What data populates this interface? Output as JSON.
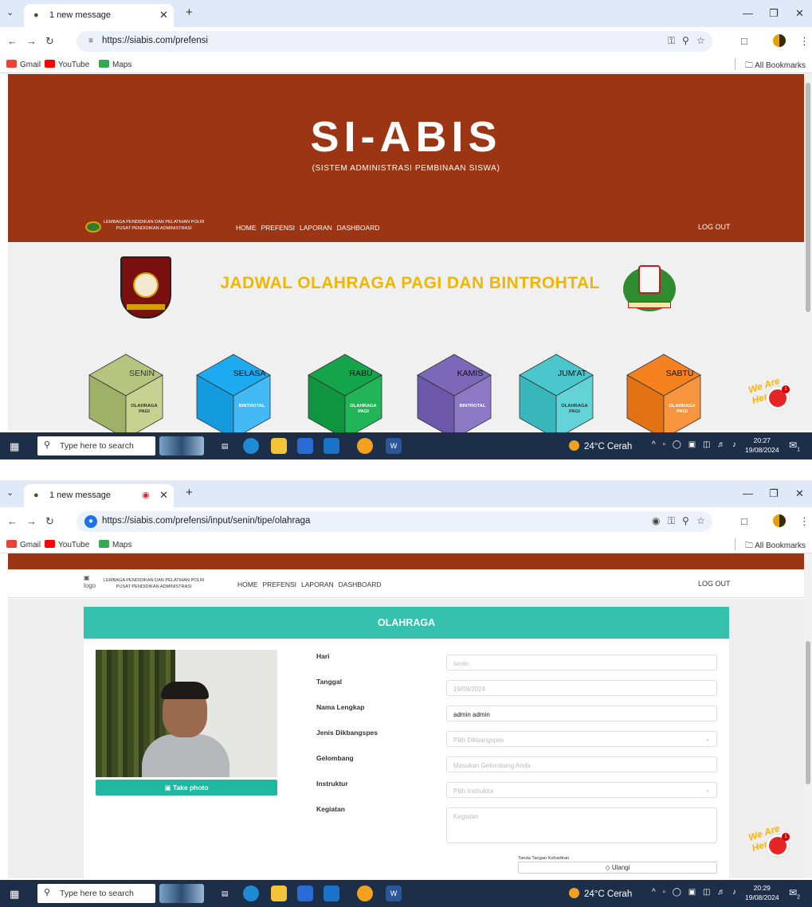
{
  "screenshot_1": {
    "browser": {
      "tab_title": "1 new message",
      "url": "https://siabis.com/prefensi",
      "bookmarks": [
        "Gmail",
        "YouTube",
        "Maps"
      ],
      "all_bookmarks": "All Bookmarks"
    },
    "site": {
      "title": "SI-ABIS",
      "subtitle": "(SISTEM ADMINISTRASI PEMBINAAN SISWA)",
      "org_line1": "LEMBAGA PENDIDIKAN DAN PELATIHAN POLRI",
      "org_line2": "PUSAT PENDIDIKAN ADMINISTRASI",
      "nav": [
        "HOME",
        "PREFENSI",
        "LAPORAN",
        "DASHBOARD"
      ],
      "logout": "LOG OUT",
      "schedule_title": "JADWAL OLAHRAGA PAGI DAN BINTROHTAL",
      "crest_left_ribbon": "SATYA HAPRABU",
      "crest_right_ribbon": "BHAKTI KARYA"
    },
    "days": [
      {
        "day": "SENIN",
        "activity": "OLAHRAGA PAGI",
        "top": "#b6c47e",
        "left": "#9fb067",
        "right": "#c7d291"
      },
      {
        "day": "SELASA",
        "activity": "BINTROTAL",
        "top": "#1eaaf0",
        "left": "#139bdd",
        "right": "#43baf5"
      },
      {
        "day": "RABU",
        "activity": "OLAHRAGA PAGI",
        "top": "#14a54a",
        "left": "#0f9440",
        "right": "#22b558"
      },
      {
        "day": "KAMIS",
        "activity": "BINTROTAL",
        "top": "#7b68b8",
        "left": "#6b58a8",
        "right": "#8b79c6"
      },
      {
        "day": "JUM'AT",
        "activity": "OLAHRAGA PAGI",
        "top": "#49c7cc",
        "left": "#39b6bb",
        "right": "#63d3d7"
      },
      {
        "day": "SABTU",
        "activity": "OLAHRAGA PAGI",
        "top": "#f5821f",
        "left": "#e37214",
        "right": "#f7963e"
      }
    ],
    "chat_badge": {
      "script": "We Are Here!",
      "count": "1"
    },
    "taskbar": {
      "search_placeholder": "Type here to search",
      "weather": "24°C Cerah",
      "time": "20:27",
      "date": "19/08/2024",
      "notifications": "1"
    }
  },
  "screenshot_2": {
    "browser": {
      "tab_title": "1 new message",
      "url": "https://siabis.com/prefensi/input/senin/tipe/olahraga",
      "bookmarks": [
        "Gmail",
        "YouTube",
        "Maps"
      ],
      "all_bookmarks": "All Bookmarks"
    },
    "site": {
      "logo_alt": "logo",
      "org_line1": "LEMBAGA PENDIDIKAN DAN PELATIHAN POLRI",
      "org_line2": "PUSAT PENDIDIKAN ADMINISTRASI",
      "nav": [
        "HOME",
        "PREFENSI",
        "LAPORAN",
        "DASHBOARD"
      ],
      "logout": "LOG OUT"
    },
    "form": {
      "header": "OLAHRAGA",
      "take_photo": "Take photo",
      "fields": {
        "hari": {
          "label": "Hari",
          "value": "senin"
        },
        "tanggal": {
          "label": "Tanggal",
          "value": "19/08/2024"
        },
        "nama": {
          "label": "Nama Lengkap",
          "value": "admin admin"
        },
        "jenis": {
          "label": "Jenis Dikbangspes",
          "placeholder": "Pilih Dikbangspes"
        },
        "gelombang": {
          "label": "Gelombang",
          "placeholder": "Masukan Gelombang Anda"
        },
        "instruktur": {
          "label": "Instruktur",
          "placeholder": "Pilih Instruktur"
        },
        "kegiatan": {
          "label": "Kegiatan",
          "placeholder": "Kegiatan"
        }
      },
      "signature_label": "Tanda Tangan Kehadiran",
      "ulangi": "Ulangi"
    },
    "chat_badge": {
      "script": "We Are Here!",
      "count": "1"
    },
    "taskbar": {
      "search_placeholder": "Type here to search",
      "weather": "24°C Cerah",
      "time": "20:29",
      "date": "19/08/2024",
      "notifications": "2"
    }
  }
}
